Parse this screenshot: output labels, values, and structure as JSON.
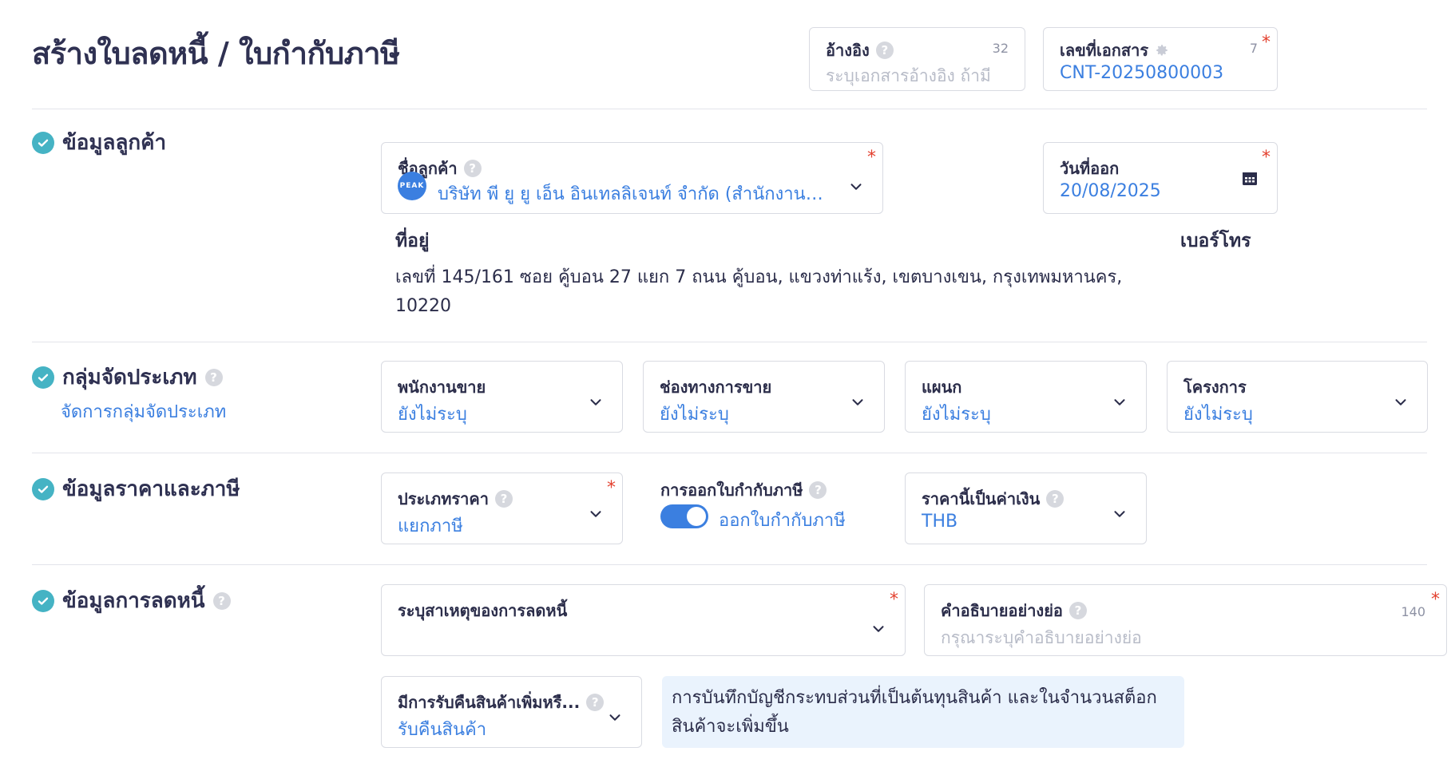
{
  "page": {
    "title": "สร้างใบลดหนี้ / ใบกำกับภาษี"
  },
  "reference": {
    "label": "อ้างอิง",
    "placeholder": "ระบุเอกสารอ้างอิง ถ้ามี",
    "counter": "32"
  },
  "doc_no": {
    "label": "เลขที่เอกสาร",
    "value": "CNT-20250800003",
    "counter": "7",
    "required_mark": "*"
  },
  "customer_section": {
    "title": "ข้อมูลลูกค้า",
    "customer": {
      "label": "ชื่อลูกค้า",
      "avatar_text": "PEAK",
      "value": "บริษัท พี ยู ยู เอ็น อินเทลลิเจนท์ จำกัด (สำนักงานให...",
      "required_mark": "*"
    },
    "issue_date": {
      "label": "วันที่ออก",
      "value": "20/08/2025",
      "required_mark": "*"
    },
    "address_label": "ที่อยู่",
    "address_line1": "เลขที่ 145/161 ซอย คู้บอน 27 แยก 7 ถนน คู้บอน, แขวงท่าแร้ง, เขตบางเขน, กรุงเทพมหานคร,",
    "address_line2": "10220",
    "phone_label": "เบอร์โทร"
  },
  "category_section": {
    "title": "กลุ่มจัดประเภท",
    "manage_link": "จัดการกลุ่มจัดประเภท",
    "salesperson": {
      "label": "พนักงานขาย",
      "value": "ยังไม่ระบุ"
    },
    "channel": {
      "label": "ช่องทางการขาย",
      "value": "ยังไม่ระบุ"
    },
    "department": {
      "label": "แผนก",
      "value": "ยังไม่ระบุ"
    },
    "project": {
      "label": "โครงการ",
      "value": "ยังไม่ระบุ"
    }
  },
  "price_section": {
    "title": "ข้อมูลราคาและภาษี",
    "price_type": {
      "label": "ประเภทราคา",
      "value": "แยกภาษี",
      "required_mark": "*"
    },
    "tax_invoice": {
      "label": "การออกใบกำกับภาษี",
      "toggle_label": "ออกใบกำกับภาษี",
      "enabled": true
    },
    "currency": {
      "label": "ราคานี้เป็นค่าเงิน",
      "value": "THB"
    }
  },
  "debit_section": {
    "title": "ข้อมูลการลดหนี้",
    "reason": {
      "label": "ระบุสาเหตุของการลดหนี้",
      "value": "",
      "required_mark": "*"
    },
    "description": {
      "label": "คำอธิบายอย่างย่อ",
      "placeholder": "กรุณาระบุคำอธิบายอย่างย่อ",
      "counter": "140",
      "required_mark": "*"
    },
    "return_goods": {
      "label": "มีการรับคืนสินค้าเพิ่มหรื...",
      "value": "รับคืนสินค้า"
    },
    "info_line1": "การบันทึกบัญชีกระทบส่วนที่เป็นต้นทุนสินค้า และในจำนวนสต็อก",
    "info_line2": "สินค้าจะเพิ่มขึ้น"
  },
  "colors": {
    "accent": "#3b7fe0",
    "check": "#45b3c4",
    "required": "#e3412f",
    "info_bg": "#eaf3fd"
  },
  "icons": [
    "check-circle-icon",
    "help-icon",
    "chevron-down-icon",
    "calendar-icon",
    "gear-icon"
  ]
}
